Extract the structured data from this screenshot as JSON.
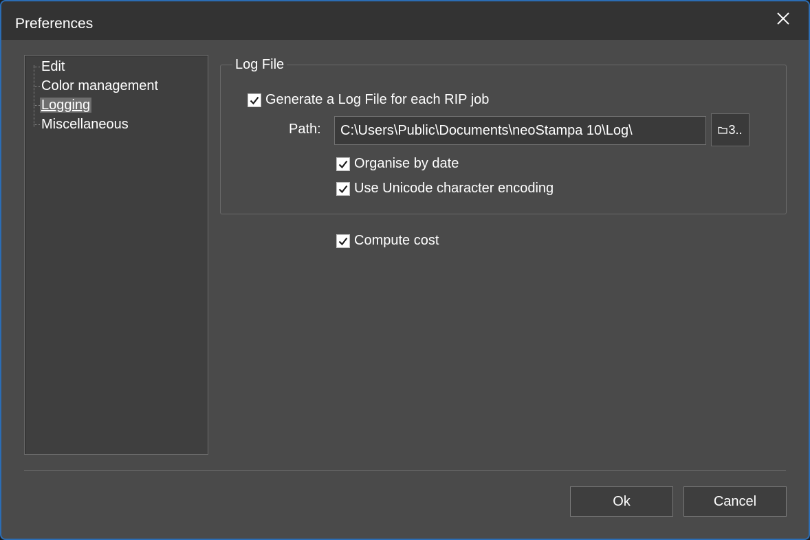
{
  "window": {
    "title": "Preferences"
  },
  "tree": {
    "items": [
      {
        "label": "Edit"
      },
      {
        "label": "Color management"
      },
      {
        "label": "Logging",
        "selected": true
      },
      {
        "label": "Miscellaneous"
      }
    ]
  },
  "log_file": {
    "legend": "Log File",
    "generate": {
      "label": "Generate a Log File for each RIP job",
      "checked": true
    },
    "path_label": "Path:",
    "path_value": "C:\\Users\\Public\\Documents\\neoStampa 10\\Log\\",
    "browse_label": "3..",
    "organise": {
      "label": "Organise by date",
      "checked": true
    },
    "unicode": {
      "label": "Use Unicode character encoding",
      "checked": true
    }
  },
  "compute_cost": {
    "label": "Compute cost",
    "checked": true
  },
  "buttons": {
    "ok": "Ok",
    "cancel": "Cancel"
  },
  "colors": {
    "window_bg": "#4a4a4a",
    "titlebar_bg": "#333333",
    "border_accent": "#2b6db5"
  },
  "icons": {
    "close": "close-icon",
    "check": "checkmark-icon",
    "folder": "folder-icon"
  }
}
